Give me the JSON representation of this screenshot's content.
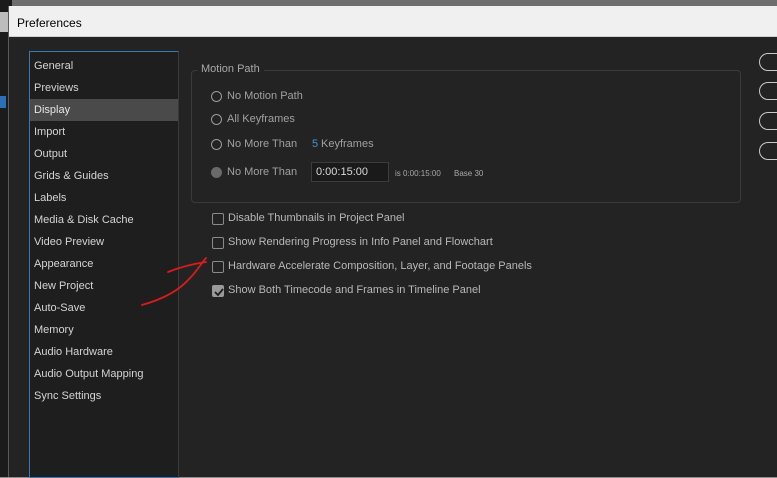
{
  "window": {
    "title": "Preferences"
  },
  "sidebar": {
    "items": [
      {
        "label": "General",
        "selected": false
      },
      {
        "label": "Previews",
        "selected": false
      },
      {
        "label": "Display",
        "selected": true
      },
      {
        "label": "Import",
        "selected": false
      },
      {
        "label": "Output",
        "selected": false
      },
      {
        "label": "Grids & Guides",
        "selected": false
      },
      {
        "label": "Labels",
        "selected": false
      },
      {
        "label": "Media & Disk Cache",
        "selected": false
      },
      {
        "label": "Video Preview",
        "selected": false
      },
      {
        "label": "Appearance",
        "selected": false
      },
      {
        "label": "New Project",
        "selected": false
      },
      {
        "label": "Auto-Save",
        "selected": false
      },
      {
        "label": "Memory",
        "selected": false
      },
      {
        "label": "Audio Hardware",
        "selected": false
      },
      {
        "label": "Audio Output Mapping",
        "selected": false
      },
      {
        "label": "Sync Settings",
        "selected": false
      }
    ]
  },
  "motion_path": {
    "title": "Motion Path",
    "options": {
      "no_motion_path": "No Motion Path",
      "all_keyframes": "All Keyframes",
      "no_more_than_1": "No More Than",
      "keyframes_count": "5",
      "keyframes_label": "Keyframes",
      "no_more_than_2": "No More Than",
      "time_value": "0:00:15:00",
      "time_note": "is 0:00:15:00",
      "base_note": "Base 30"
    },
    "selected_option": "no_more_than_time"
  },
  "checkboxes": [
    {
      "label": "Disable Thumbnails in Project Panel",
      "checked": false
    },
    {
      "label": "Show Rendering Progress in Info Panel and Flowchart",
      "checked": false
    },
    {
      "label": "Hardware Accelerate Composition, Layer, and Footage Panels",
      "checked": false
    },
    {
      "label": "Show Both Timecode and Frames in Timeline Panel",
      "checked": true
    }
  ],
  "colors": {
    "annotation": "#d81c1c",
    "accent": "#4a90d9"
  }
}
